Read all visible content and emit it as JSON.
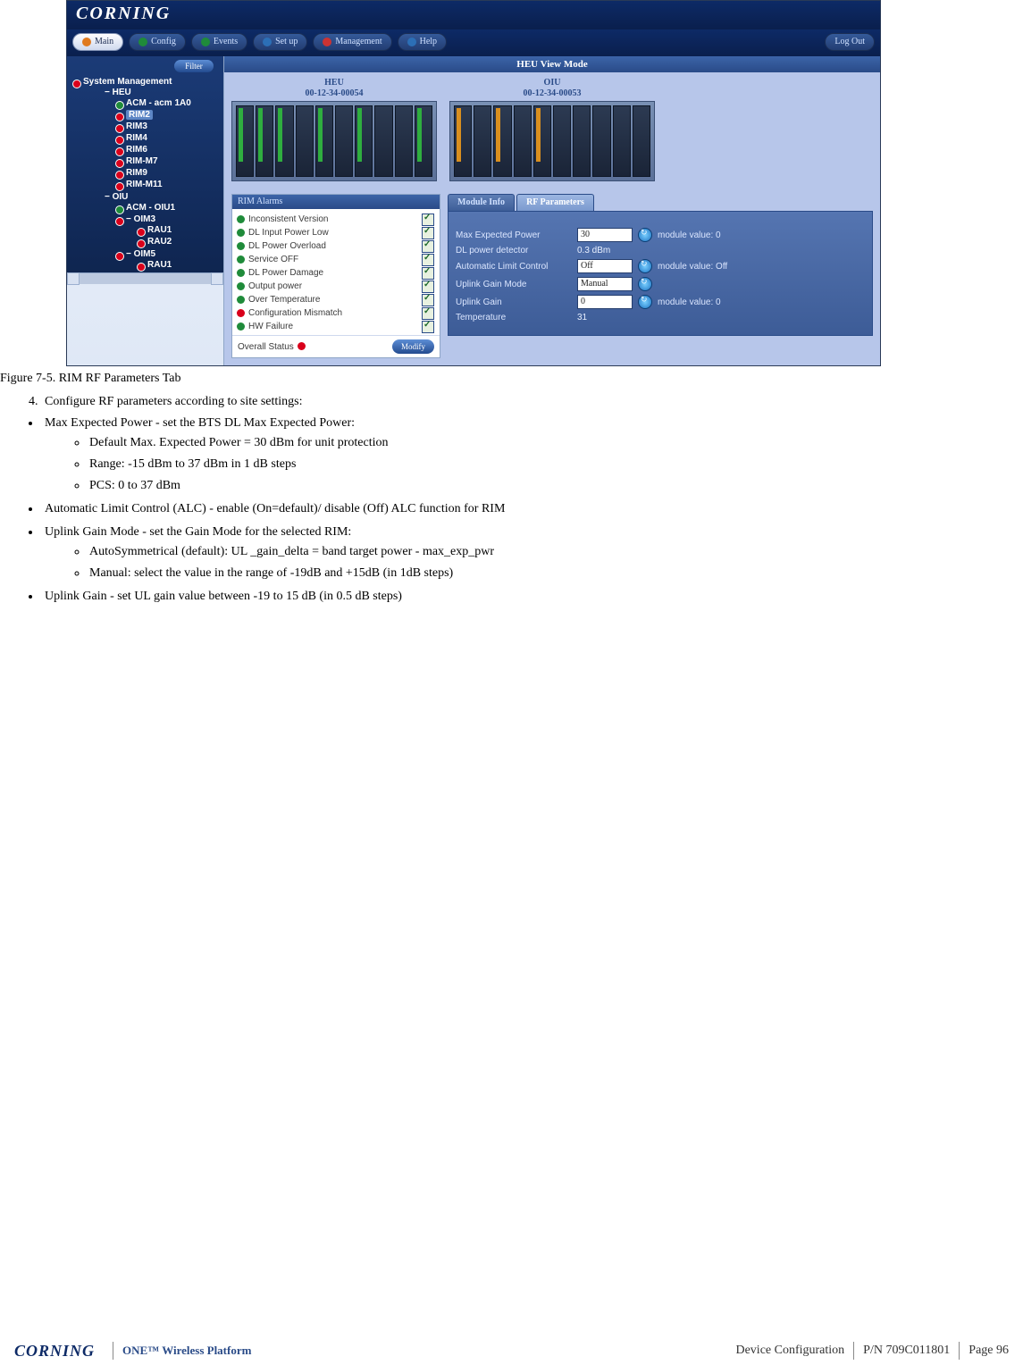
{
  "ui": {
    "brand": "CORNING",
    "menu": {
      "main": "Main",
      "config": "Config",
      "events": "Events",
      "setup": "Set up",
      "management": "Management",
      "help": "Help",
      "logout": "Log Out"
    },
    "sidebar": {
      "filter": "Filter",
      "root": "System Management",
      "heu": "HEU",
      "acm": "ACM - acm 1A0",
      "rims": [
        "RIM2",
        "RIM3",
        "RIM4",
        "RIM6",
        "RIM-M7",
        "RIM9",
        "RIM-M11"
      ],
      "oiu": "OIU",
      "oiu_acm": "ACM - OIU1",
      "oim3": "OIM3",
      "oim3_children": [
        "RAU1",
        "RAU2"
      ],
      "oim5": "OIM5",
      "oim5_children": [
        "RAU1"
      ]
    },
    "viewmode": "HEU View Mode",
    "cards": [
      {
        "title": "HEU",
        "id": "00-12-34-00054"
      },
      {
        "title": "OIU",
        "id": "00-12-34-00053"
      }
    ],
    "alarms": {
      "header": "RIM Alarms",
      "items": [
        {
          "label": "Inconsistent Version",
          "ok": true
        },
        {
          "label": "DL Input Power Low",
          "ok": true
        },
        {
          "label": "DL Power Overload",
          "ok": true
        },
        {
          "label": "Service OFF",
          "ok": true
        },
        {
          "label": "DL Power Damage",
          "ok": true
        },
        {
          "label": "Output power",
          "ok": true
        },
        {
          "label": "Over Temperature",
          "ok": true
        },
        {
          "label": "Configuration Mismatch",
          "ok": false
        },
        {
          "label": "HW Failure",
          "ok": true
        }
      ],
      "overall": "Overall Status",
      "modify": "Modify"
    },
    "tabs": {
      "info": "Module Info",
      "rf": "RF Parameters"
    },
    "rf": {
      "mep_label": "Max Expected Power",
      "mep_value": "30",
      "mep_note": "module value: 0",
      "dlpd_label": "DL power detector",
      "dlpd_value": "0.3 dBm",
      "alc_label": "Automatic Limit Control",
      "alc_value": "Off",
      "alc_note": "module value: Off",
      "ugm_label": "Uplink Gain Mode",
      "ugm_value": "Manual",
      "ug_label": "Uplink Gain",
      "ug_value": "0",
      "ug_note": "module value: 0",
      "temp_label": "Temperature",
      "temp_value": "31"
    }
  },
  "doc": {
    "caption": "Figure 7-5. RIM RF Parameters Tab",
    "step4": "Configure RF parameters according to site settings:",
    "b1": "Max Expected Power - set the BTS DL Max Expected Power:",
    "b1s1": "Default Max. Expected Power = 30 dBm for unit protection",
    "b1s2": "Range: -15 dBm to 37 dBm in 1 dB steps",
    "b1s3": "PCS: 0 to 37 dBm",
    "b2": "Automatic Limit Control (ALC) - enable (On=default)/ disable (Off) ALC function for RIM",
    "b3": "Uplink Gain Mode - set the Gain Mode for the selected RIM:",
    "b3s1": "AutoSymmetrical (default): UL _gain_delta = band target power - max_exp_pwr",
    "b3s2": "Manual: select the value in the range of -19dB and +15dB (in 1dB steps)",
    "b4": "Uplink Gain - set UL gain value between -19 to 15 dB (in 0.5 dB steps)"
  },
  "footer": {
    "brand": "CORNING",
    "platform": "ONE™ Wireless Platform",
    "section": "Device Configuration",
    "pn": "P/N 709C011801",
    "page": "Page 96"
  }
}
